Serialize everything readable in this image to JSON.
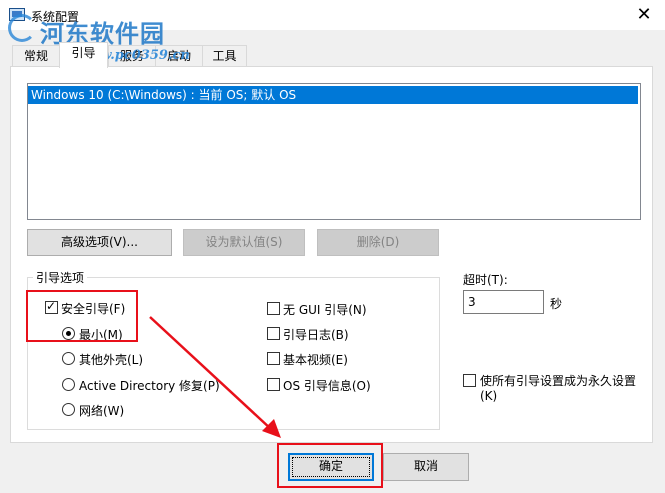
{
  "window": {
    "title": "系统配置",
    "close_glyph": "✕"
  },
  "watermark": {
    "text": "河东软件园",
    "url": "www.pc0359.cn"
  },
  "tabs": [
    "常规",
    "引导",
    "服务",
    "启动",
    "工具"
  ],
  "boot_entries": [
    "Windows 10 (C:\\Windows) : 当前 OS; 默认 OS"
  ],
  "boot_buttons": {
    "advanced": "高级选项(V)...",
    "set_default": "设为默认值(S)",
    "delete": "删除(D)"
  },
  "boot_options": {
    "group_label": "引导选项",
    "safe_boot": {
      "label": "安全引导(F)",
      "checked": true
    },
    "modes": [
      {
        "label": "最小(M)",
        "selected": true
      },
      {
        "label": "其他外壳(L)",
        "selected": false
      },
      {
        "label": "Active Directory 修复(P)",
        "selected": false
      },
      {
        "label": "网络(W)",
        "selected": false
      }
    ],
    "flags": [
      {
        "label": "无 GUI 引导(N)",
        "checked": false
      },
      {
        "label": "引导日志(B)",
        "checked": false
      },
      {
        "label": "基本视频(E)",
        "checked": false
      },
      {
        "label": "OS 引导信息(O)",
        "checked": false
      }
    ]
  },
  "timeout": {
    "label": "超时(T):",
    "value": "3",
    "unit": "秒"
  },
  "permanent": {
    "label_line1": "使所有引导设置成为永久设置",
    "label_line2": "(K)",
    "checked": false
  },
  "footer": {
    "ok": "确定",
    "cancel": "取消"
  },
  "colors": {
    "selection": "#0078d7",
    "annotation": "#e8101a"
  }
}
